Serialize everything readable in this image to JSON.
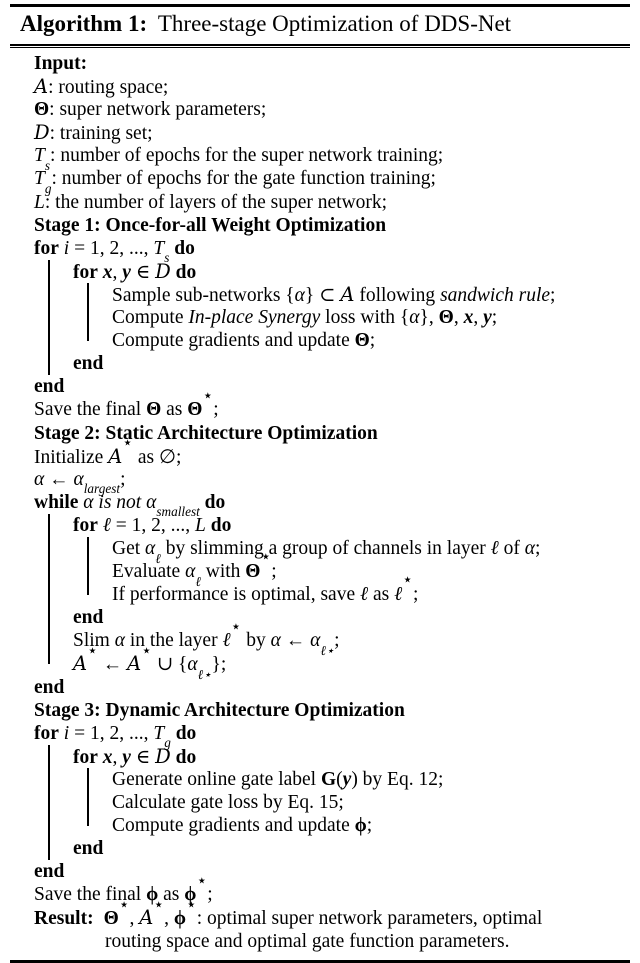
{
  "caption": {
    "head": "Algorithm 1:",
    "title": "Three-stage Optimization of DDS-Net"
  },
  "input_header": "Input:",
  "inputs": [
    {
      "symbol": "A",
      "text": ": routing space;"
    },
    {
      "symbol": "Θ",
      "text": ": super network parameters;"
    },
    {
      "symbol": "D",
      "text": ": training set;"
    },
    {
      "symbol": "T",
      "sub": "s",
      "text": ": number of epochs for the super network training;"
    },
    {
      "symbol": "T",
      "sub": "g",
      "text": ": number of epochs for the gate function training;"
    },
    {
      "symbol": "L",
      "text": ": the number of layers of the super network;"
    }
  ],
  "stage1": {
    "header": "Stage 1: Once-for-all Weight Optimization",
    "for_outer": {
      "kw": "for",
      "range": "i = 1, 2, ..., T",
      "sub": "s",
      "do": "do"
    },
    "for_inner": {
      "kw": "for",
      "range": "x, y ∈ D",
      "do": "do"
    },
    "body": [
      "Sample sub-networks {α} ⊂ A following sandwich rule;",
      "Compute In-place Synergy loss with {α}, Θ, x, y;",
      "Compute gradients and update Θ;"
    ],
    "end_inner": "end",
    "end_outer": "end",
    "save": "Save the final Θ as Θ⋆;"
  },
  "stage2": {
    "header": "Stage 2: Static Architecture Optimization",
    "init": "Initialize A⋆ as ∅;",
    "assign": "α ← αlargest;",
    "while": {
      "kw": "while",
      "cond": "α is not αsmallest",
      "do": "do"
    },
    "for_inner": {
      "kw": "for",
      "range": "ℓ = 1, 2, ..., L",
      "do": "do"
    },
    "body": [
      "Get αℓ by slimming a group of channels in layer ℓ of α;",
      "Evaluate αℓ with Θ⋆;",
      "If performance is optimal, save ℓ as ℓ⋆;"
    ],
    "end_inner": "end",
    "slim": "Slim α in the layer ℓ⋆ by α ← αℓ⋆;",
    "union": "A⋆ ← A⋆ ∪ {αℓ⋆};",
    "end_outer": "end"
  },
  "stage3": {
    "header": "Stage 3: Dynamic Architecture Optimization",
    "for_outer": {
      "kw": "for",
      "range": "i = 1, 2, ..., T",
      "sub": "g",
      "do": "do"
    },
    "for_inner": {
      "kw": "for",
      "range": "x, y ∈ D",
      "do": "do"
    },
    "body": [
      "Generate online gate label G(y) by Eq. 12;",
      "Calculate gate loss by Eq. 15;",
      "Compute gradients and update φ;"
    ],
    "end_inner": "end",
    "end_outer": "end",
    "save": "Save the final φ as φ⋆;"
  },
  "result": {
    "label": "Result:",
    "line1": "Θ⋆, A⋆, φ⋆: optimal super network parameters, optimal",
    "line2": "routing space and optimal gate function parameters."
  },
  "colors": {
    "text": "#000000",
    "background": "#ffffff",
    "rule": "#000000"
  }
}
